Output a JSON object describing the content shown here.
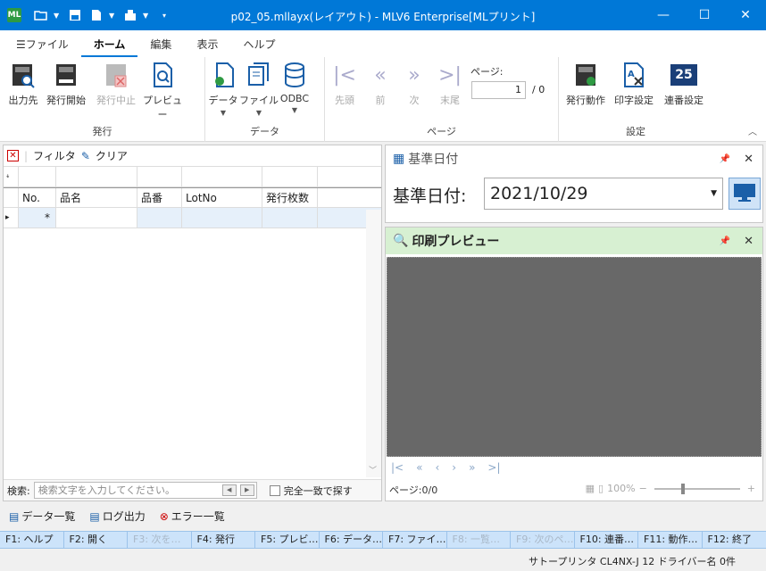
{
  "window": {
    "title": "p02_05.mllayx(レイアウト) - MLV6 Enterprise[MLプリント]",
    "app_icon_text": "ML",
    "controls": [
      "minimize-icon",
      "maximize-icon",
      "close-icon"
    ]
  },
  "qat": [
    "open-folder-icon",
    "print-icon",
    "export-icon",
    "label-icon",
    "customize-icon"
  ],
  "tabs": [
    "ファイル",
    "ホーム",
    "編集",
    "表示",
    "ヘルプ"
  ],
  "ribbon": {
    "groups": {
      "issue": {
        "label": "発行",
        "buttons": [
          "出力先",
          "発行開始",
          "発行中止",
          "プレビュー"
        ]
      },
      "data": {
        "label": "データ",
        "buttons": [
          "データ",
          "ファイル",
          "ODBC"
        ]
      },
      "page": {
        "label": "ページ",
        "buttons": [
          "先頭",
          "前",
          "次",
          "末尾"
        ],
        "page_label": "ページ:",
        "page_value": "1",
        "page_total": "/ 0"
      },
      "settings": {
        "label": "設定",
        "buttons": [
          "発行動作",
          "印字設定",
          "連番設定"
        ],
        "serial_icon_text": "25"
      }
    }
  },
  "grid": {
    "filter_label": "フィルタ",
    "clear_label": "クリア",
    "columns": [
      "No.",
      "品名",
      "品番",
      "LotNo",
      "発行枚数"
    ],
    "new_row_marker": "*",
    "row_indicator": "▸"
  },
  "search": {
    "label": "検索:",
    "placeholder": "検索文字を入力してください。",
    "exact_label": "完全一致で探す"
  },
  "date_pane": {
    "title": "基準日付",
    "label": "基準日付:",
    "value": "2021/10/29"
  },
  "preview_pane": {
    "title": "印刷プレビュー",
    "page_status": "ページ:0/0",
    "zoom": "100%",
    "zoom_minus": "−",
    "zoom_plus": "+"
  },
  "bottom_links": [
    "データ一覧",
    "ログ出力",
    "エラー一覧"
  ],
  "fkeys": [
    {
      "label": "F1: ヘルプ",
      "enabled": true
    },
    {
      "label": "F2: 開く",
      "enabled": true
    },
    {
      "label": "F3: 次を…",
      "enabled": false
    },
    {
      "label": "F4: 発行",
      "enabled": true
    },
    {
      "label": "F5: プレビ…",
      "enabled": true
    },
    {
      "label": "F6: データ…",
      "enabled": true
    },
    {
      "label": "F7: ファイ…",
      "enabled": true
    },
    {
      "label": "F8: 一覧…",
      "enabled": false
    },
    {
      "label": "F9: 次のペ…",
      "enabled": false
    },
    {
      "label": "F10: 連番…",
      "enabled": true
    },
    {
      "label": "F11: 動作…",
      "enabled": true
    },
    {
      "label": "F12: 終了",
      "enabled": true
    }
  ],
  "status": {
    "printer": "サトープリンタ CL4NX-J 12 ドライバー名 0件"
  },
  "colors": {
    "accent": "#0078d7",
    "preview_header": "#d7f0d2",
    "fkey_bar": "#cce3fa"
  }
}
